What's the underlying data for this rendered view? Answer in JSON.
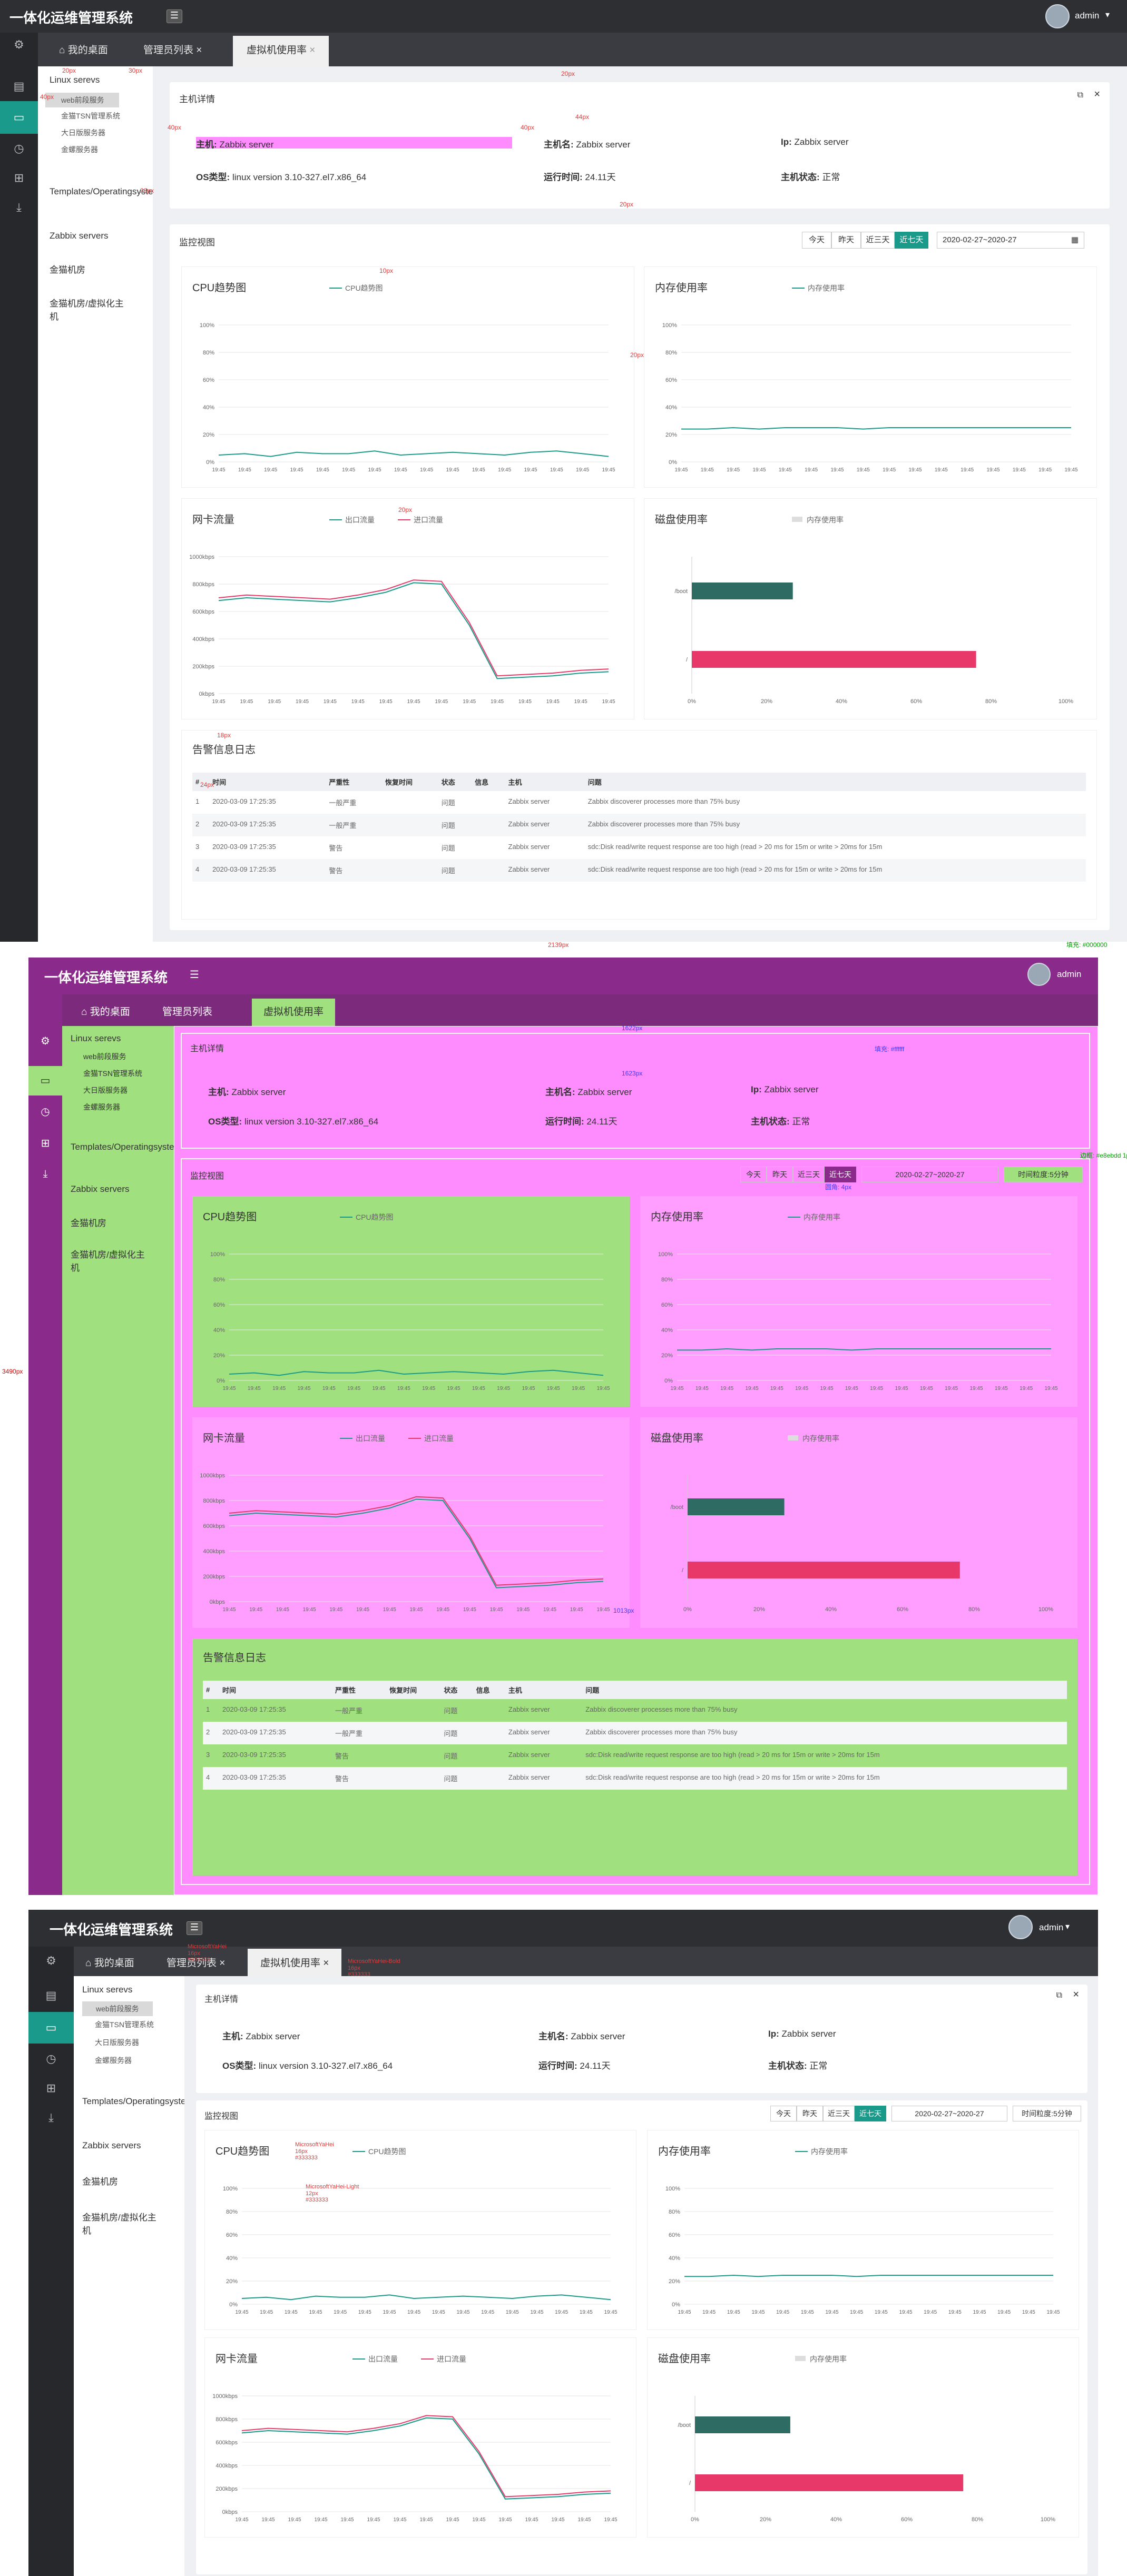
{
  "app": {
    "title": "一体化运维管理系统",
    "user": "admin",
    "tabs": [
      "我的桌面",
      "管理员列表",
      "虚拟机使用率"
    ]
  },
  "sidebar": {
    "groups": [
      {
        "label": "Linux serevs",
        "children": [
          "web前段服务",
          "金猫TSN管理系统",
          "大日版服务器",
          "金螺服务器"
        ]
      },
      {
        "label": "Templates/Operatingsystems",
        "children": []
      },
      {
        "label": "Zabbix servers",
        "children": []
      },
      {
        "label": "金猫机房",
        "children": []
      },
      {
        "label": "金猫机房/虚拟化主机",
        "children": []
      }
    ]
  },
  "host": {
    "section_title": "主机详情",
    "host_label": "主机:",
    "host_value": "Zabbix server",
    "hostname_label": "主机名:",
    "hostname_value": "Zabbix server",
    "ip_label": "Ip:",
    "ip_value": "Zabbix server",
    "os_label": "OS类型:",
    "os_value": "linux version 3.10-327.el7.x86_64",
    "uptime_label": "运行时间:",
    "uptime_value": "24.11天",
    "status_label": "主机状态:",
    "status_value": "正常"
  },
  "monitor": {
    "section_title": "监控视图",
    "range_buttons": [
      "今天",
      "昨天",
      "近三天",
      "近七天"
    ],
    "active_range": "近七天",
    "date_range": "2020-02-27~2020-27",
    "granularity_label": "时间粒度:",
    "granularity_value": "5分钟"
  },
  "chart_data": [
    {
      "type": "line",
      "title": "CPU趋势图",
      "series": [
        {
          "name": "CPU趋势图",
          "color": "#1a9a8a",
          "values": [
            5,
            6,
            4,
            7,
            6,
            6,
            8,
            5,
            6,
            7,
            6,
            5,
            7,
            8,
            6,
            4
          ]
        }
      ],
      "x": [
        "19:45",
        "19:45",
        "19:45",
        "19:45",
        "19:45",
        "19:45",
        "19:45",
        "19:45",
        "19:45",
        "19:45",
        "19:45",
        "19:45",
        "19:45",
        "19:45",
        "19:45",
        "19:45"
      ],
      "y_ticks": [
        "0%",
        "20%",
        "40%",
        "60%",
        "80%",
        "100%"
      ],
      "ylim": [
        0,
        100
      ]
    },
    {
      "type": "line",
      "title": "内存使用率",
      "series": [
        {
          "name": "内存使用率",
          "color": "#1a9a8a",
          "values": [
            24,
            24,
            25,
            24,
            25,
            25,
            25,
            24,
            25,
            25,
            25,
            25,
            25,
            25,
            25,
            25
          ]
        }
      ],
      "x": [
        "19:45",
        "19:45",
        "19:45",
        "19:45",
        "19:45",
        "19:45",
        "19:45",
        "19:45",
        "19:45",
        "19:45",
        "19:45",
        "19:45",
        "19:45",
        "19:45",
        "19:45",
        "19:45"
      ],
      "y_ticks": [
        "0%",
        "20%",
        "40%",
        "60%",
        "80%",
        "100%"
      ],
      "ylim": [
        0,
        100
      ]
    },
    {
      "type": "line",
      "title": "网卡流量",
      "series": [
        {
          "name": "出口流量",
          "color": "#1a9a8a",
          "values": [
            680,
            700,
            690,
            680,
            670,
            700,
            740,
            810,
            800,
            500,
            110,
            120,
            130,
            150,
            160
          ]
        },
        {
          "name": "进口流量",
          "color": "#e83a6a",
          "values": [
            700,
            720,
            710,
            700,
            690,
            720,
            760,
            830,
            820,
            520,
            130,
            140,
            150,
            170,
            180
          ]
        }
      ],
      "x": [
        "19:45",
        "19:45",
        "19:45",
        "19:45",
        "19:45",
        "19:45",
        "19:45",
        "19:45",
        "19:45",
        "19:45",
        "19:45",
        "19:45",
        "19:45",
        "19:45",
        "19:45"
      ],
      "y_ticks": [
        "0kbps",
        "200kbps",
        "400kbps",
        "600kbps",
        "800kbps",
        "1000kbps"
      ],
      "ylim": [
        0,
        1000
      ]
    },
    {
      "type": "bar",
      "title": "磁盘使用率",
      "legend": "内存使用率",
      "categories": [
        "/boot",
        "/"
      ],
      "values": [
        27,
        76
      ],
      "colors": [
        "#2e6b63",
        "#e8386a"
      ],
      "x_ticks": [
        "0%",
        "20%",
        "40%",
        "60%",
        "80%",
        "100%"
      ],
      "xlim": [
        0,
        100
      ]
    }
  ],
  "alerts": {
    "title": "告警信息日志",
    "columns": [
      "#",
      "时间",
      "严重性",
      "恢复时间",
      "状态",
      "信息",
      "主机",
      "问题"
    ],
    "rows": [
      [
        "1",
        "2020-03-09 17:25:35",
        "一般严重",
        "",
        "问题",
        "",
        "Zabbix server",
        "Zabbix discoverer processes more than 75% busy"
      ],
      [
        "2",
        "2020-03-09 17:25:35",
        "一般严重",
        "",
        "问题",
        "",
        "Zabbix server",
        "Zabbix discoverer processes more than 75% busy"
      ],
      [
        "3",
        "2020-03-09 17:25:35",
        "警告",
        "",
        "问题",
        "",
        "Zabbix server",
        "sdc:Disk read/write request response are too high (read > 20 ms for 15m or write > 20ms for 15m"
      ],
      [
        "4",
        "2020-03-09 17:25:35",
        "警告",
        "",
        "问题",
        "",
        "Zabbix server",
        "sdc:Disk read/write request response are too high (read > 20 ms for 15m or write > 20ms for 15m"
      ]
    ]
  },
  "annotations": {
    "px20": "20px",
    "px16": "16px",
    "px40": "40px",
    "px30": "30px",
    "px22": "22px",
    "px18": "18px",
    "px44": "44px",
    "px10": "10px",
    "px12": "12px",
    "px14": "14px",
    "px24": "24px",
    "px32": "32px",
    "px5": "5px",
    "px4": "4px",
    "px1": "1px",
    "w1622": "1622px",
    "w1623": "1623px",
    "w1620": "1620px",
    "w1678": "1678px",
    "w1686": "1686px",
    "w2139": "2139px",
    "h3490": "3490px",
    "h1012": "1012px",
    "h1013": "1013px",
    "fill_ffffff": "填充: #ffffff",
    "fill_000000": "填充: #000000",
    "border_e": "边框: #e8ebdd 1px",
    "radius_4": "圆角: 4px",
    "font_yahei": "MicrosoftYaHei",
    "font_yahei_bold": "MicrosoftYaHei-Bold",
    "font_yahei_light": "MicrosoftYaHei-Light",
    "color_333": "#333333",
    "color_666": "#666666",
    "left": "left"
  }
}
